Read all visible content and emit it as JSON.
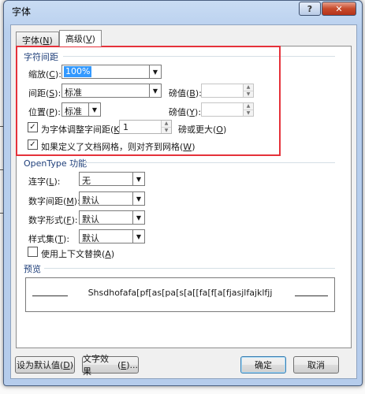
{
  "window": {
    "title": "字体",
    "help_label": "?",
    "close_label": "✕"
  },
  "tabs": [
    {
      "label": "字体",
      "key": "N"
    },
    {
      "label": "高级",
      "key": "V"
    }
  ],
  "spacing": {
    "title": "字符间距",
    "scale_label": "缩放",
    "scale_key": "C",
    "scale_value": "100%",
    "spacing_label": "间距",
    "spacing_key": "S",
    "spacing_value": "标准",
    "spacing_by_label": "磅值",
    "spacing_by_key": "B",
    "position_label": "位置",
    "position_key": "P",
    "position_value": "标准",
    "position_by_label": "磅值",
    "position_by_key": "Y",
    "kerning_label": "为字体调整字间距",
    "kerning_key": "K",
    "kerning_value": "1",
    "kerning_suffix": "磅或更大",
    "kerning_suffix_key": "O",
    "kerning_checked": true,
    "grid_label": "如果定义了文档网格，则对齐到网格",
    "grid_key": "W",
    "grid_checked": true
  },
  "opentype": {
    "title": "OpenType 功能",
    "ligatures_label": "连字",
    "ligatures_key": "L",
    "ligatures_value": "无",
    "num_spacing_label": "数字间距",
    "num_spacing_key": "M",
    "num_spacing_value": "默认",
    "num_forms_label": "数字形式",
    "num_forms_key": "F",
    "num_forms_value": "默认",
    "stylistic_label": "样式集",
    "stylistic_key": "T",
    "stylistic_value": "默认",
    "contextual_label": "使用上下文替换",
    "contextual_key": "A",
    "contextual_checked": false
  },
  "preview": {
    "title": "预览",
    "text": "Shsdhofafa[pf[as[pa[s[a[[fa[f[a[fjasjlfajklfjj"
  },
  "buttons": {
    "set_default": "设为默认值",
    "set_default_key": "D",
    "text_effects": "文字效果",
    "text_effects_key": "E",
    "text_effects_suffix": "...",
    "ok": "确定",
    "cancel": "取消"
  }
}
